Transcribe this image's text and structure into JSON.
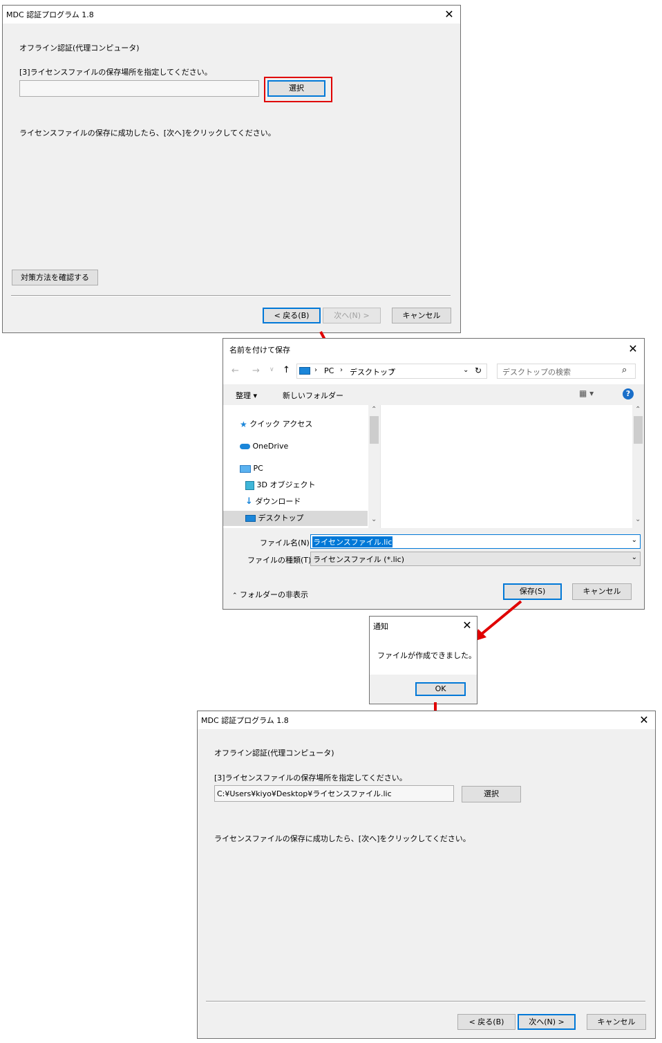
{
  "window1": {
    "title": "MDC 認証プログラム 1.8",
    "close": "✕",
    "heading": "オフライン認証(代理コンピュータ)",
    "instruction": "[3]ライセンスファイルの保存場所を指定してください。",
    "path_value": "",
    "select_button": "選択",
    "note": "ライセンスファイルの保存に成功したら、[次へ]をクリックしてください。",
    "fix_button": "対策方法を確認する",
    "back_button": "< 戻る(B)",
    "next_button": "次へ(N) >",
    "cancel_button": "キャンセル"
  },
  "save_dialog": {
    "title": "名前を付けて保存",
    "close": "✕",
    "breadcrumb": [
      "PC",
      "デスクトップ"
    ],
    "search_placeholder": "デスクトップの検索",
    "organize": "整理 ▾",
    "new_folder": "新しいフォルダー",
    "nav_items": [
      "クイック アクセス",
      "OneDrive",
      "PC",
      "3D オブジェクト",
      "ダウンロード",
      "デスクトップ"
    ],
    "filename_label": "ファイル名(N):",
    "filename_value": "ライセンスファイル.lic",
    "filetype_label": "ファイルの種類(T):",
    "filetype_value": "ライセンスファイル (*.lic)",
    "hide_folders": "フォルダーの非表示",
    "save_button": "保存(S)",
    "cancel_button": "キャンセル",
    "help": "?"
  },
  "notice_dialog": {
    "title": "通知",
    "close": "✕",
    "message": "ファイルが作成できました。",
    "ok_button": "OK"
  },
  "window2": {
    "title": "MDC 認証プログラム 1.8",
    "close": "✕",
    "heading": "オフライン認証(代理コンピュータ)",
    "instruction": "[3]ライセンスファイルの保存場所を指定してください。",
    "path_value": "C:¥Users¥kiyo¥Desktop¥ライセンスファイル.lic",
    "select_button": "選択",
    "note": "ライセンスファイルの保存に成功したら、[次へ]をクリックしてください。",
    "back_button": "< 戻る(B)",
    "next_button": "次へ(N) >",
    "cancel_button": "キャンセル"
  },
  "colors": {
    "highlight_red": "#e00000",
    "accent_blue": "#0078d7",
    "selection_blue": "#0078d7",
    "help_blue": "#1a6fc9"
  }
}
